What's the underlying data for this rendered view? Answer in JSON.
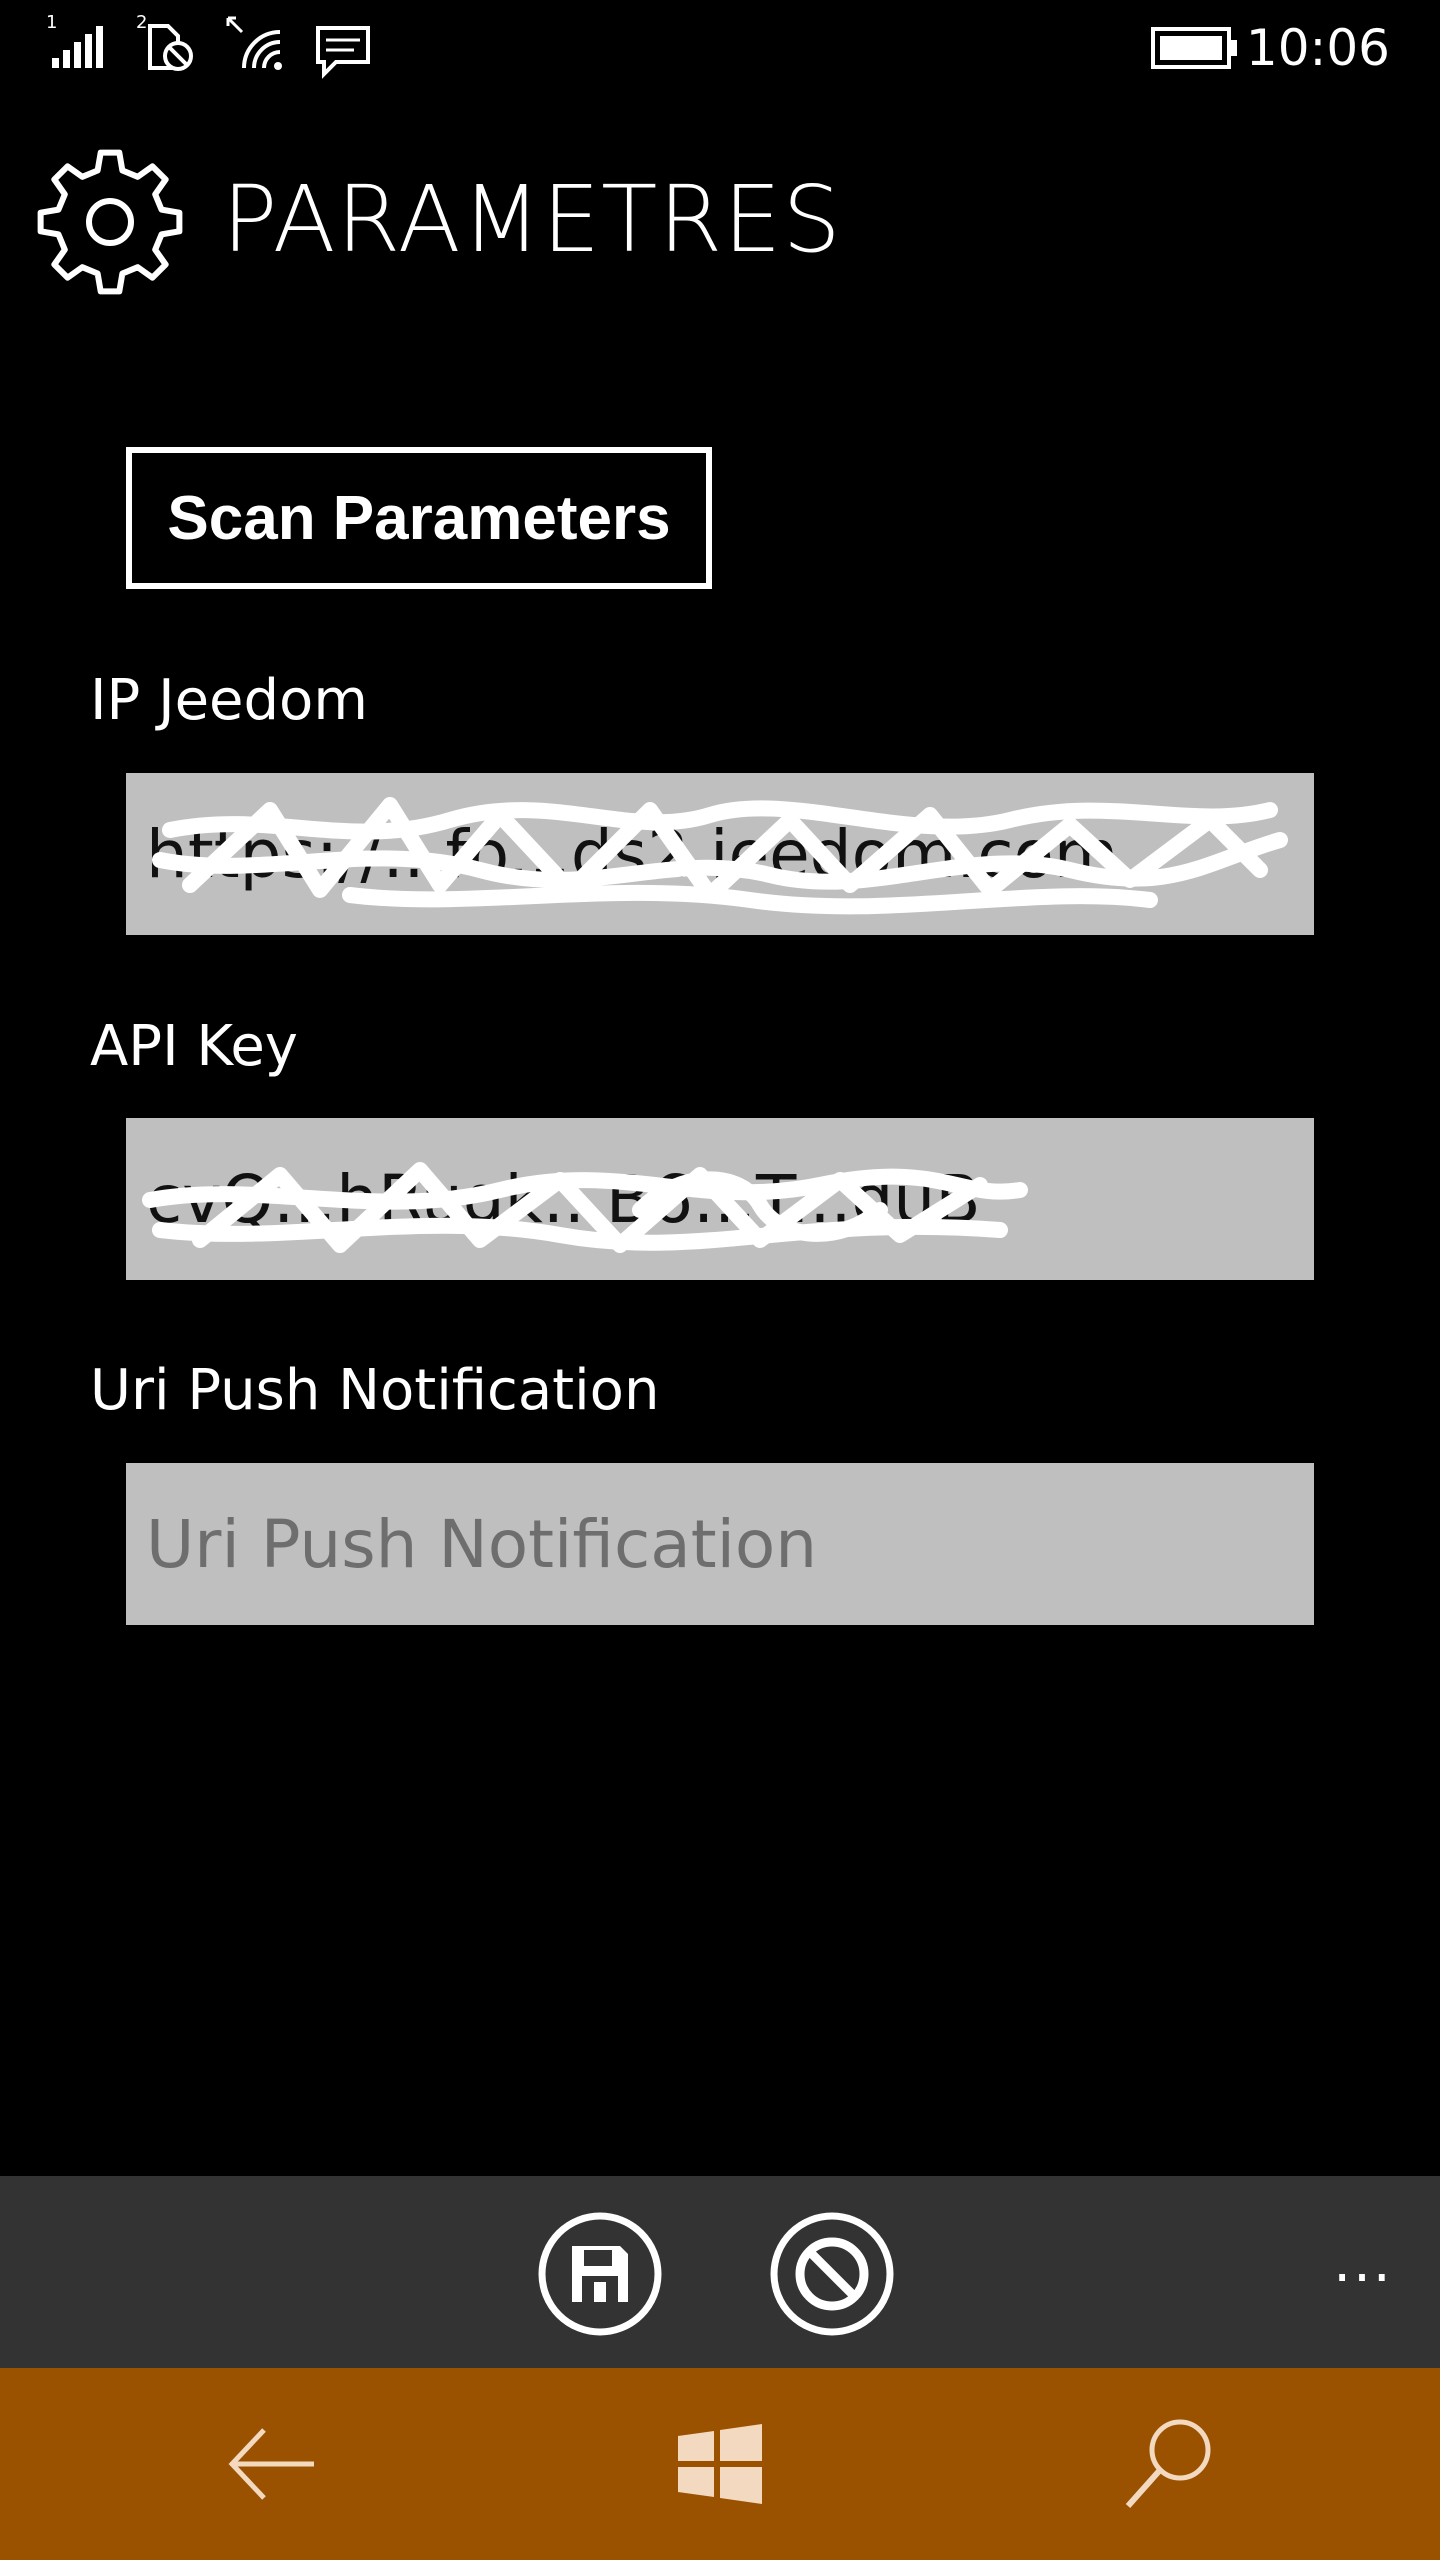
{
  "status_bar": {
    "sim1_label": "1",
    "sim2_label": "2",
    "time": "10:06",
    "icons": [
      "signal-strength-icon",
      "sim-no-signal-icon",
      "wifi-icon",
      "message-icon",
      "battery-icon"
    ]
  },
  "header": {
    "icon": "gear-icon",
    "title": "PARAMETRES"
  },
  "scan_button": {
    "label": "Scan Parameters"
  },
  "fields": {
    "ip": {
      "label": "IP Jeedom",
      "value": "https://...fo...ds2.jeedom.com",
      "redacted": true
    },
    "api_key": {
      "label": "API Key",
      "value": "cvQ...hRugk...B6...T...duB",
      "redacted": true
    },
    "uri_push": {
      "label": "Uri Push Notification",
      "value": "",
      "placeholder": "Uri Push Notification"
    }
  },
  "app_bar": {
    "buttons": [
      "save-icon",
      "cancel-icon"
    ],
    "more_label": "..."
  },
  "nav_bar": {
    "buttons": [
      "back-arrow-icon",
      "windows-start-icon",
      "search-icon"
    ]
  },
  "colors": {
    "background": "#000000",
    "input_background": "#bfbfbf",
    "app_bar": "#333333",
    "nav_bar_accent": "#9a5200",
    "text": "#ffffff"
  }
}
